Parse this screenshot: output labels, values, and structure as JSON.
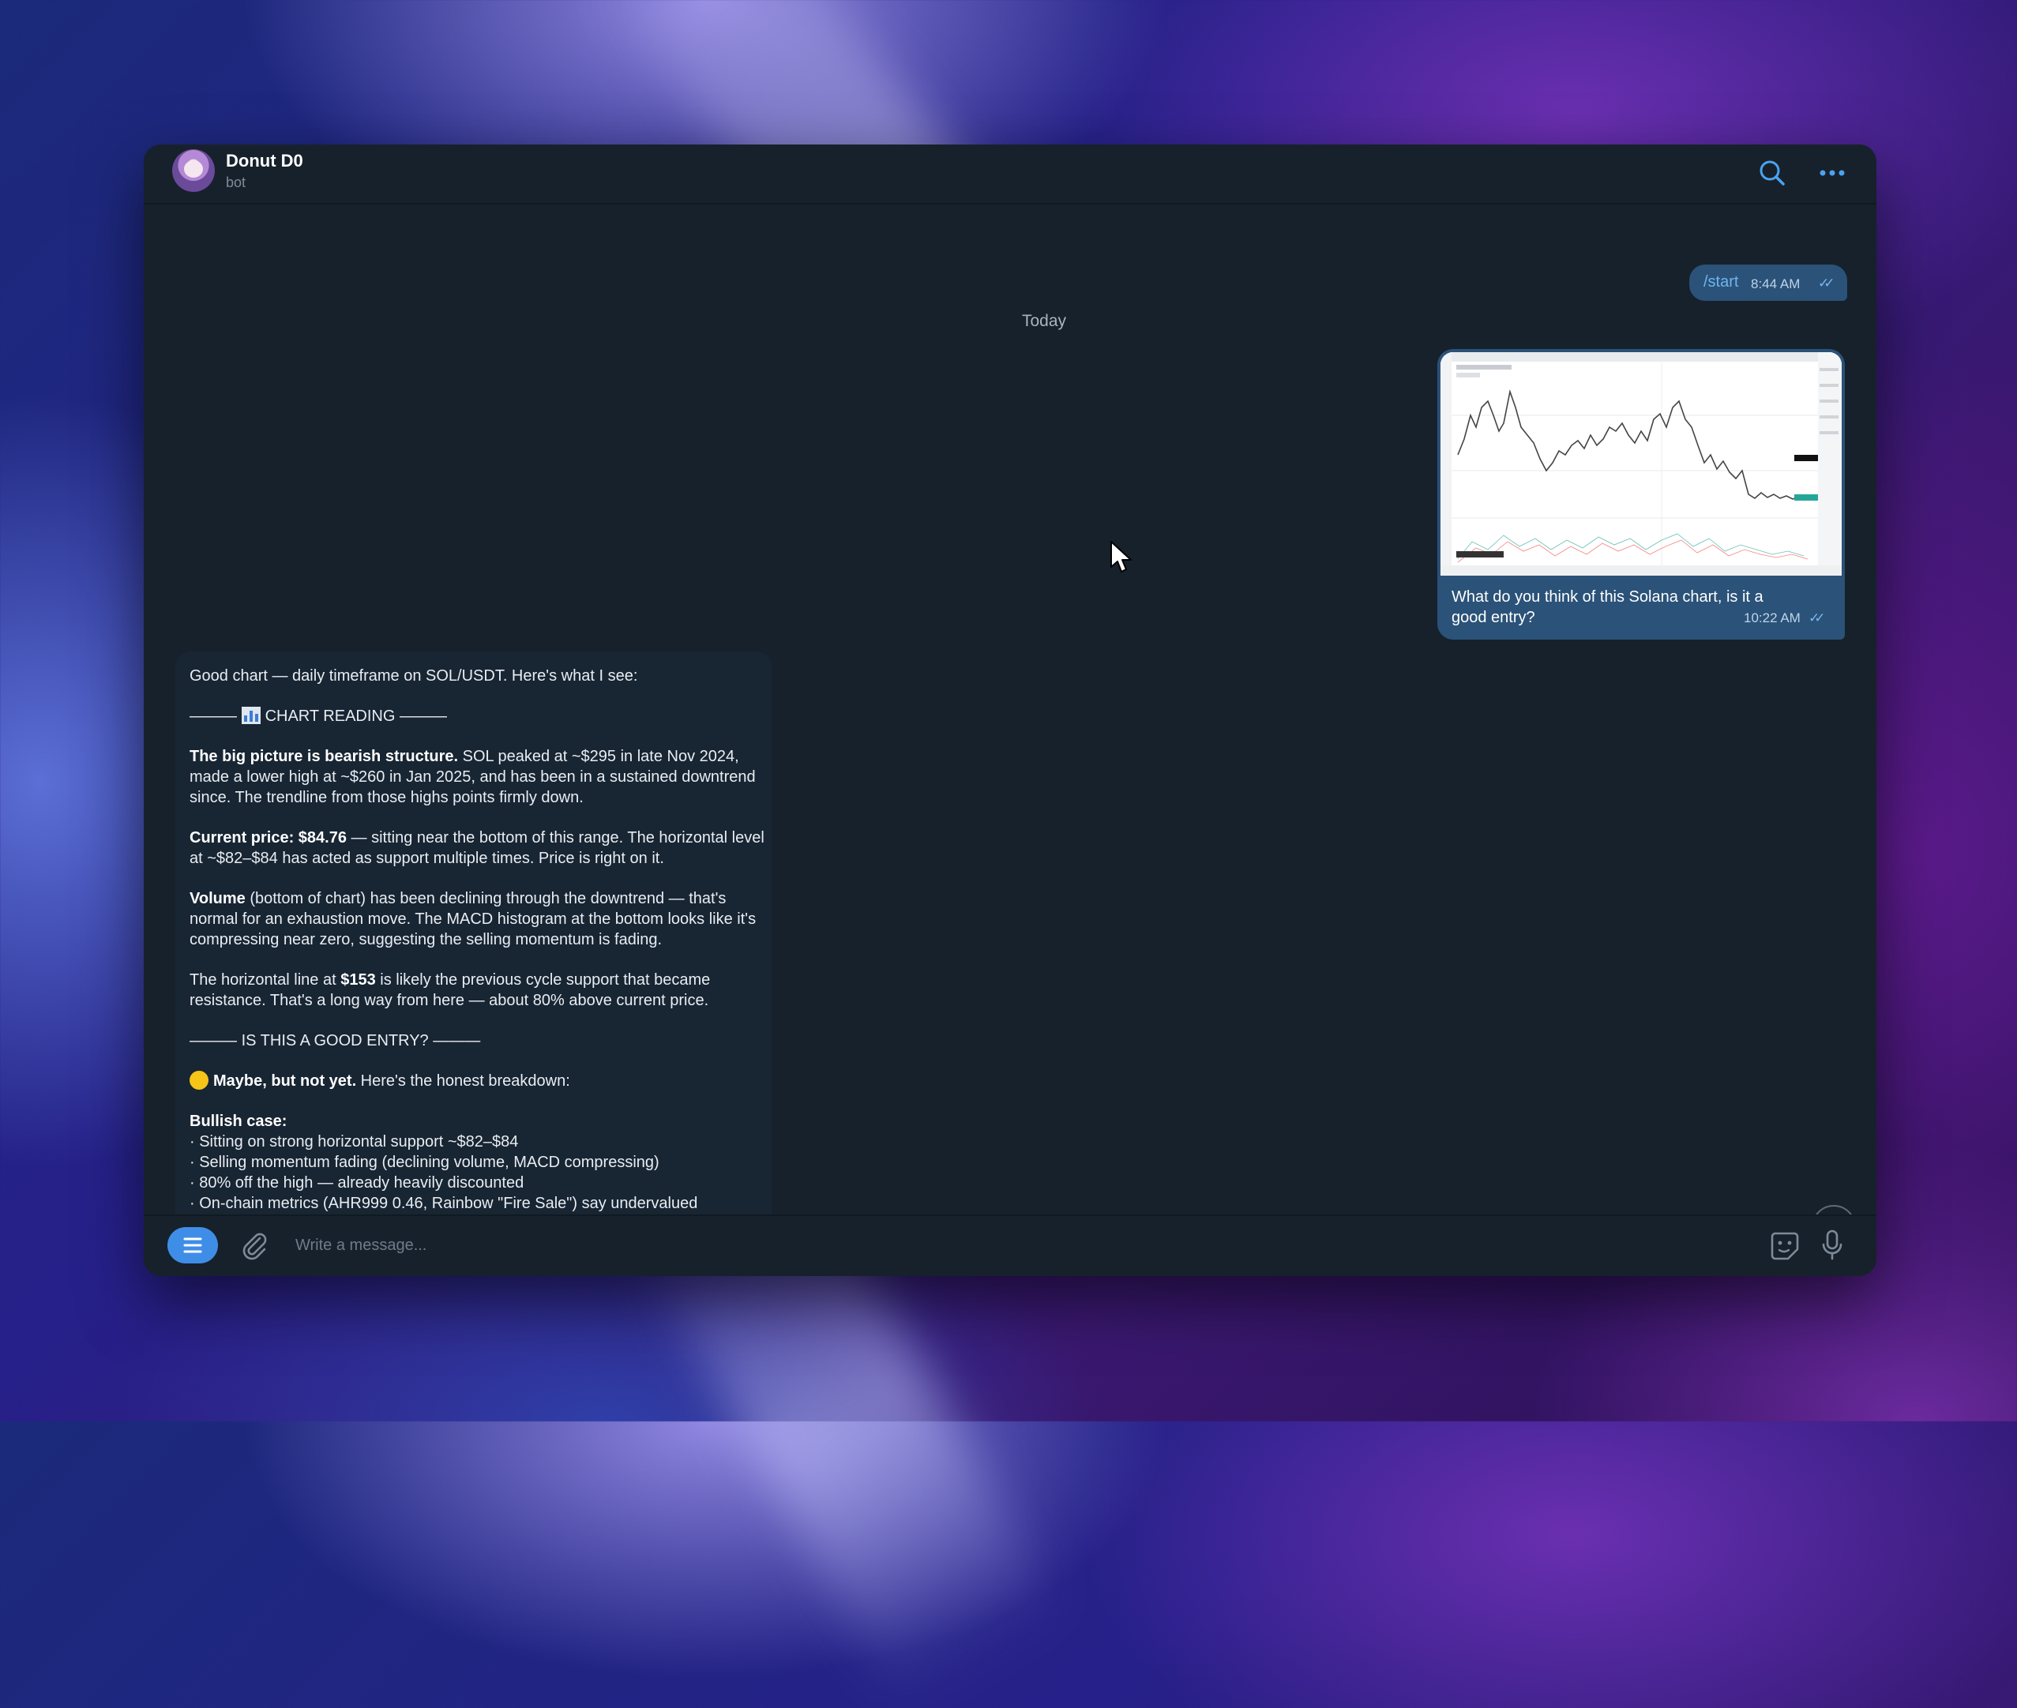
{
  "chat": {
    "title": "Donut D0",
    "subtitle": "bot",
    "date_separator": "Today",
    "composer_placeholder": "Write a message..."
  },
  "messages": {
    "start": {
      "text": "/start",
      "time": "8:44 AM"
    },
    "chart_image": {
      "caption": "What do you think of this Solana chart, is it a good entry?",
      "time": "10:22 AM"
    },
    "bot_reply": {
      "intro": "Good chart — daily timeframe on SOL/USDT. Here's what I see:",
      "section1": "CHART READING",
      "big_picture_bold": "The big picture is bearish structure.",
      "big_picture_text": " SOL peaked at ~$295 in late Nov 2024, made a lower high at ~$260 in Jan 2025, and has been in a sustained downtrend since. The trendline from those highs points firmly down.",
      "current_price_bold": "Current price: $84.76",
      "current_price_text": " — sitting near the bottom of this range. The horizontal level at ~$82–$84 has acted as support multiple times. Price is right on it.",
      "volume_bold": "Volume",
      "volume_text": " (bottom of chart) has been declining through the downtrend — that's normal for an exhaustion move. The MACD histogram at the bottom looks like it's compressing near zero, suggesting the selling momentum is fading.",
      "horizontal_pre": "The horizontal line at ",
      "horizontal_bold": "$153",
      "horizontal_text": " is likely the previous cycle support that became resistance. That's a long way from here — about 80% above current price.",
      "section2": "IS THIS A GOOD ENTRY?",
      "maybe_bold": "Maybe, but not yet.",
      "maybe_text": " Here's the honest breakdown:",
      "bullish_title": "Bullish case:",
      "bullish_items": [
        "· Sitting on strong horizontal support ~$82–$84",
        "· Selling momentum fading (declining volume, MACD compressing)",
        "· 80% off the high — already heavily discounted",
        "· On-chain metrics (AHR999 0.46, Rainbow \"Fire Sale\") say undervalued"
      ]
    }
  },
  "colors": {
    "window_bg": "#17212b",
    "outgoing_bubble": "#2b5278",
    "incoming_bubble": "#182533",
    "accent": "#3e8ee8"
  }
}
